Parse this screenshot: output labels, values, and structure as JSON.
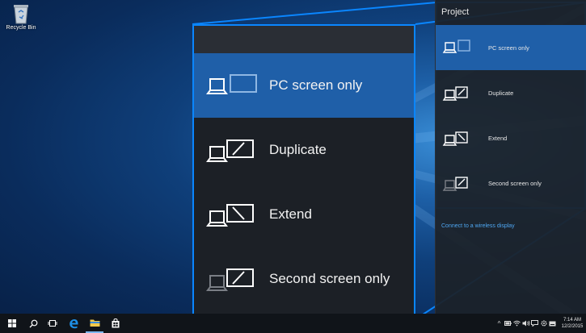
{
  "desktop": {
    "recycle_bin_label": "Recycle Bin"
  },
  "project_pane": {
    "title": "Project",
    "items": [
      {
        "label": "PC screen only",
        "selected": true
      },
      {
        "label": "Duplicate",
        "selected": false
      },
      {
        "label": "Extend",
        "selected": false
      },
      {
        "label": "Second screen only",
        "selected": false
      }
    ],
    "wireless_link": "Connect to a wireless display"
  },
  "zoom_panel": {
    "items": [
      {
        "label": "PC screen only",
        "selected": true
      },
      {
        "label": "Duplicate",
        "selected": false
      },
      {
        "label": "Extend",
        "selected": false
      },
      {
        "label": "Second screen only",
        "selected": false
      }
    ]
  },
  "taskbar": {
    "icons": [
      "windows-start-icon",
      "search-icon",
      "task-view-icon",
      "edge-browser-icon",
      "file-explorer-icon",
      "store-icon"
    ],
    "tray_icons": [
      "chevron-up-icon",
      "battery-icon",
      "network-icon",
      "volume-icon",
      "action-center-icon",
      "settings-icon",
      "keyboard-icon"
    ],
    "time": "7:14 AM",
    "date": "12/2/2015"
  },
  "colors": {
    "accent": "#0a86ff",
    "selected": "#1f5fa8",
    "panel": "#1c2026",
    "link": "#4ea6f2"
  }
}
